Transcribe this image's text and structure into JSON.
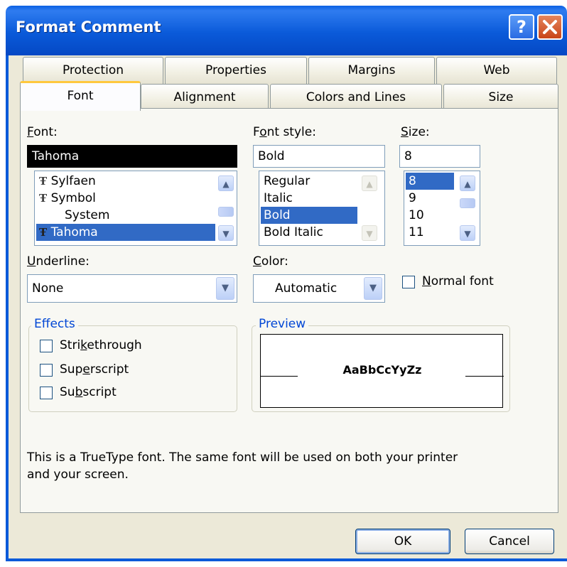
{
  "dialog": {
    "title": "Format Comment",
    "help_glyph": "?",
    "close_glyph": "✕"
  },
  "tabs": {
    "back_row": [
      "Protection",
      "Properties",
      "Margins",
      "Web"
    ],
    "front_row": [
      "Font",
      "Alignment",
      "Colors and Lines",
      "Size"
    ],
    "active": "Font"
  },
  "font": {
    "label_pre": "",
    "label_key": "F",
    "label_post": "ont:",
    "value": "Tahoma",
    "list": [
      {
        "name": "Sylfaen",
        "truetype": true
      },
      {
        "name": "Symbol",
        "truetype": true
      },
      {
        "name": "System",
        "truetype": false
      },
      {
        "name": "Tahoma",
        "truetype": true,
        "selected": true
      }
    ]
  },
  "font_style": {
    "label_pre": "F",
    "label_key": "o",
    "label_post": "nt style:",
    "value": "Bold",
    "list": [
      "Regular",
      "Italic",
      "Bold",
      "Bold Italic"
    ],
    "selected": "Bold"
  },
  "size": {
    "label_pre": "",
    "label_key": "S",
    "label_post": "ize:",
    "value": "8",
    "list": [
      "8",
      "9",
      "10",
      "11"
    ],
    "selected": "8"
  },
  "underline": {
    "label_pre": "",
    "label_key": "U",
    "label_post": "nderline:",
    "value": "None"
  },
  "color": {
    "label_pre": "",
    "label_key": "C",
    "label_post": "olor:",
    "value": "Automatic"
  },
  "normal_font": {
    "label_pre": "",
    "label_key": "N",
    "label_post": "ormal font",
    "checked": false
  },
  "effects": {
    "legend": "Effects",
    "items": [
      {
        "pre": "Stri",
        "key": "k",
        "post": "ethrough",
        "checked": false
      },
      {
        "pre": "Sup",
        "key": "e",
        "post": "rscript",
        "checked": false
      },
      {
        "pre": "Su",
        "key": "b",
        "post": "script",
        "checked": false
      }
    ]
  },
  "preview": {
    "legend": "Preview",
    "sample": "AaBbCcYyZz"
  },
  "info": {
    "line1": "This is a TrueType font.  The same font will be used on both your printer",
    "line2": "and your screen."
  },
  "buttons": {
    "ok": "OK",
    "cancel": "Cancel"
  },
  "icons": {
    "truetype": "Ŧ",
    "scroll_up": "▲",
    "scroll_down": "▼",
    "combo_down": "▼"
  }
}
